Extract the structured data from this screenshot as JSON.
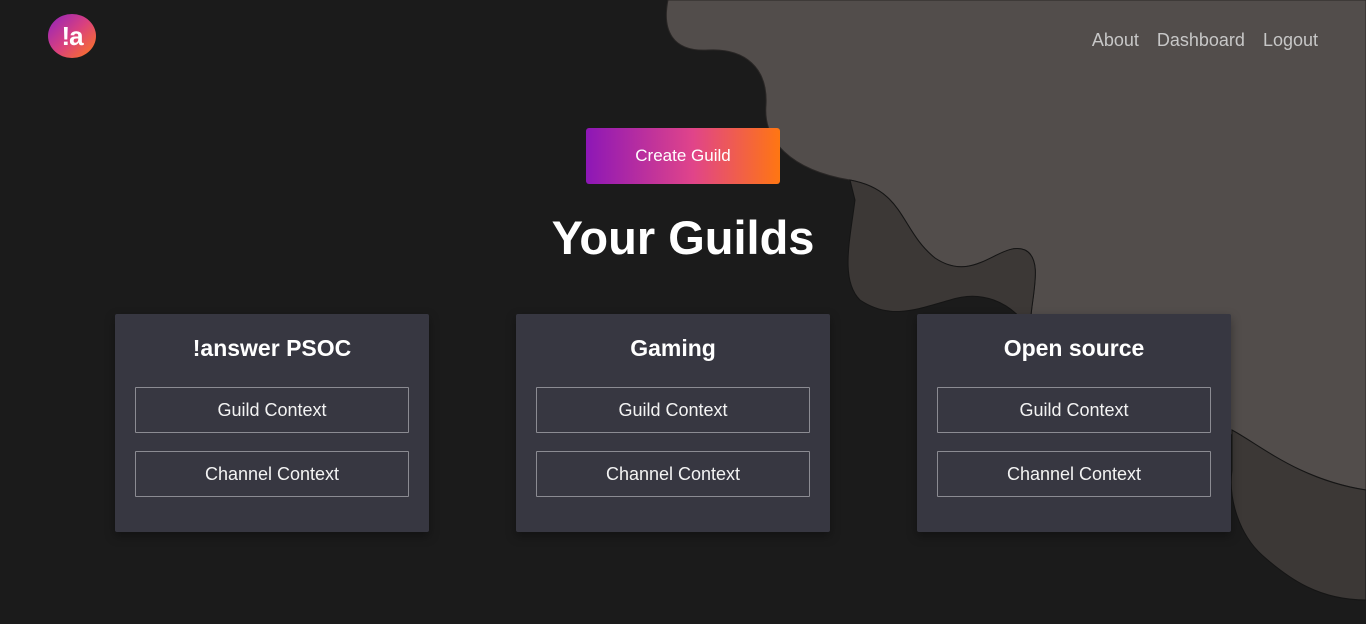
{
  "header": {
    "logo_text": "!a",
    "nav": [
      {
        "label": "About"
      },
      {
        "label": "Dashboard"
      },
      {
        "label": "Logout"
      }
    ]
  },
  "main": {
    "create_button_label": "Create Guild",
    "title": "Your Guilds",
    "guilds": [
      {
        "name": "!answer PSOC",
        "guild_context_label": "Guild Context",
        "channel_context_label": "Channel Context"
      },
      {
        "name": "Gaming",
        "guild_context_label": "Guild Context",
        "channel_context_label": "Channel Context"
      },
      {
        "name": "Open source",
        "guild_context_label": "Guild Context",
        "channel_context_label": "Channel Context"
      }
    ]
  },
  "colors": {
    "background": "#1b1b1b",
    "card": "#373741",
    "blob_light": "#524d4b",
    "blob_dark": "#3b3735",
    "accent_start": "#8d17b6",
    "accent_mid": "#e0448a",
    "accent_end": "#ff7612"
  }
}
